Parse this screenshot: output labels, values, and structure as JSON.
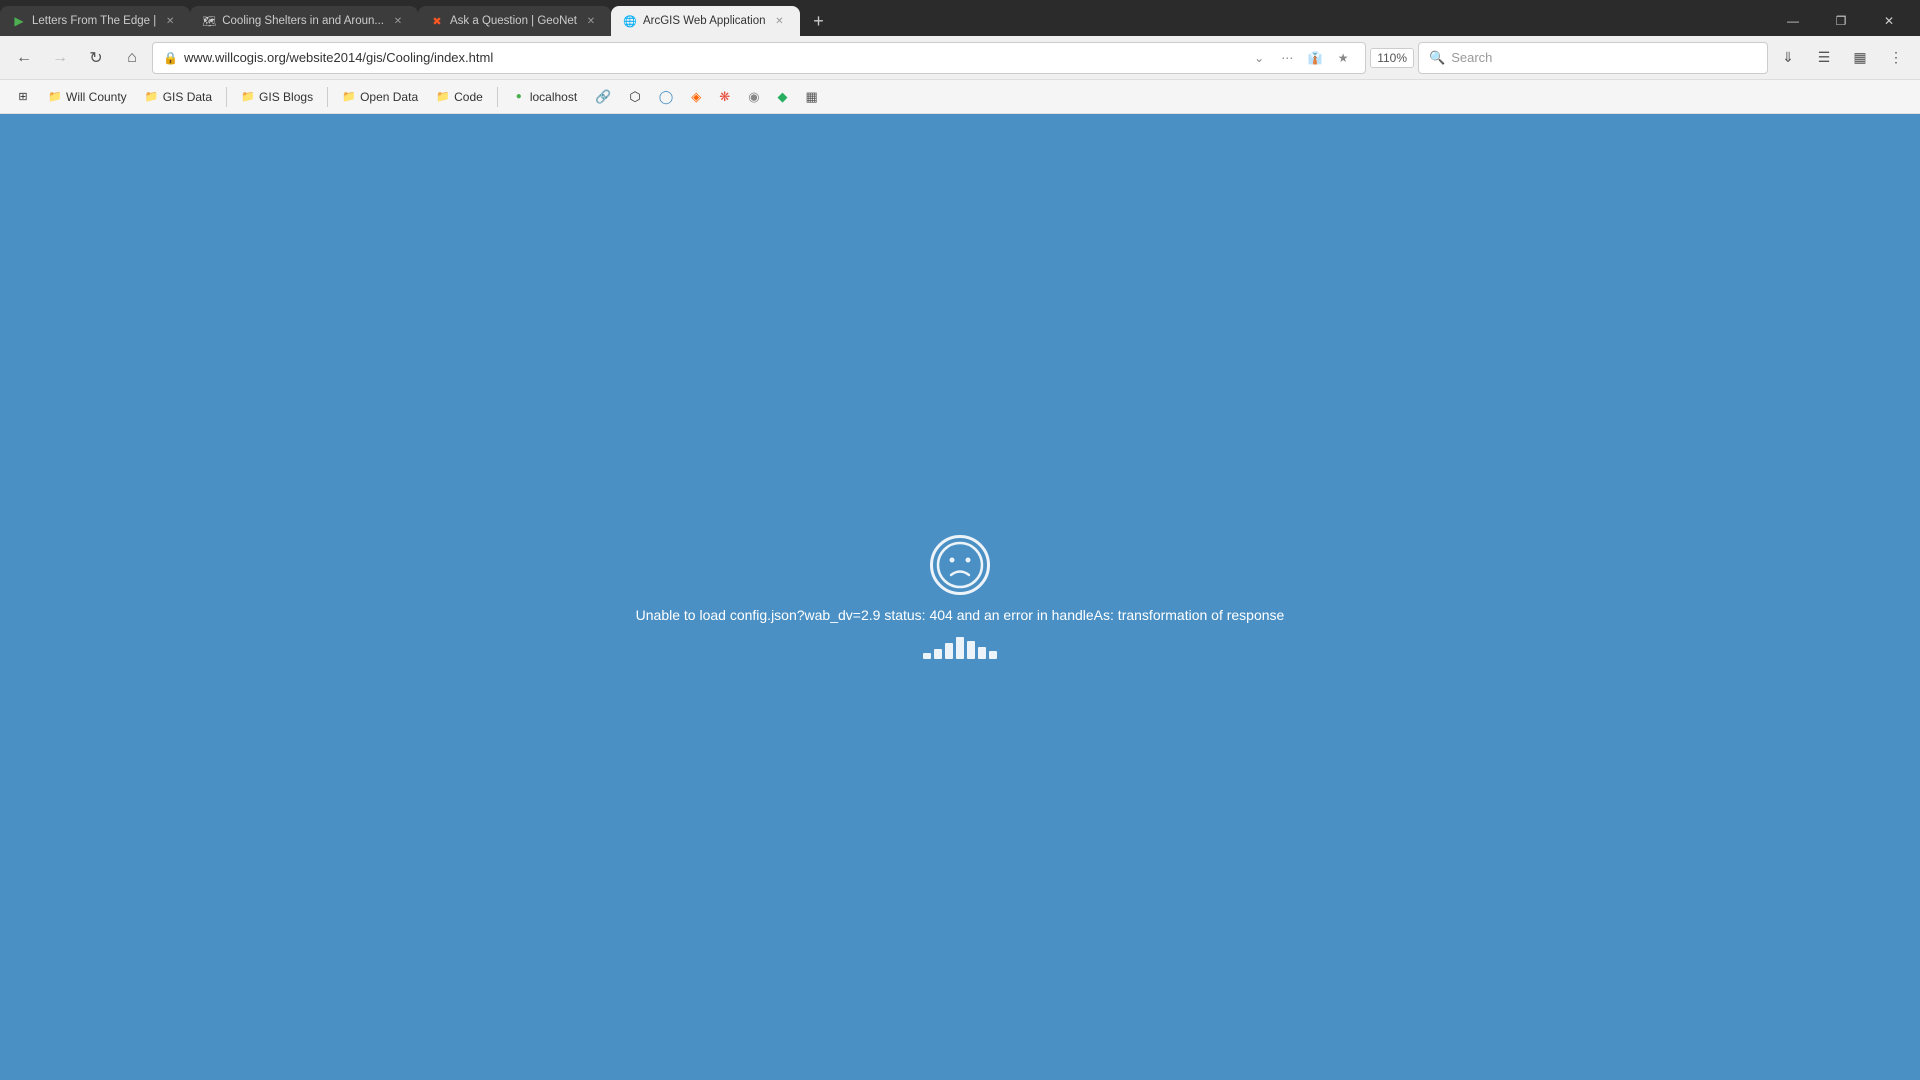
{
  "browser": {
    "tabs": [
      {
        "id": "tab-1",
        "label": "Letters From The Edge |",
        "icon": "▶",
        "icon_color": "#4CAF50",
        "active": false,
        "closable": true
      },
      {
        "id": "tab-2",
        "label": "Cooling Shelters in and Aroun...",
        "icon": "🗺",
        "icon_color": "#4a90c4",
        "active": false,
        "closable": true
      },
      {
        "id": "tab-3",
        "label": "Ask a Question | GeoNet",
        "icon": "🔶",
        "icon_color": "#FF5722",
        "active": false,
        "closable": true
      },
      {
        "id": "tab-4",
        "label": "ArcGIS Web Application",
        "icon": "🌐",
        "icon_color": "#4A90C4",
        "active": true,
        "closable": true
      }
    ],
    "nav": {
      "url": "www.willcogis.org/website2014/gis/Cooling/index.html",
      "zoom": "110%",
      "search_placeholder": "Search"
    },
    "window_controls": {
      "minimize": "—",
      "restore": "❐",
      "close": "✕"
    },
    "bookmarks": [
      {
        "id": "bm-apps",
        "label": "",
        "icon": "⊞",
        "type": "icon-only"
      },
      {
        "id": "bm-will-county",
        "label": "Will County",
        "icon": "📁",
        "type": "folder"
      },
      {
        "id": "bm-gis-data",
        "label": "GIS Data",
        "icon": "📁",
        "type": "folder"
      },
      {
        "id": "bm-sep1",
        "type": "separator"
      },
      {
        "id": "bm-gis-blogs",
        "label": "GIS Blogs",
        "icon": "📁",
        "type": "folder"
      },
      {
        "id": "bm-sep2",
        "type": "separator"
      },
      {
        "id": "bm-open-data",
        "label": "Open Data",
        "icon": "📁",
        "type": "folder"
      },
      {
        "id": "bm-code",
        "label": "Code",
        "icon": "📁",
        "type": "folder"
      },
      {
        "id": "bm-sep3",
        "type": "separator"
      },
      {
        "id": "bm-localhost",
        "label": "localhost",
        "icon": "🌐",
        "type": "bookmark"
      }
    ]
  },
  "page": {
    "background_color": "#4a90c4",
    "error": {
      "message": "Unable to load config.json?wab_dv=2.9 status: 404 and an error in handleAs: transformation of response",
      "face": "☹",
      "loading_bars": [
        3,
        8,
        14,
        20,
        16,
        10,
        6
      ]
    }
  }
}
